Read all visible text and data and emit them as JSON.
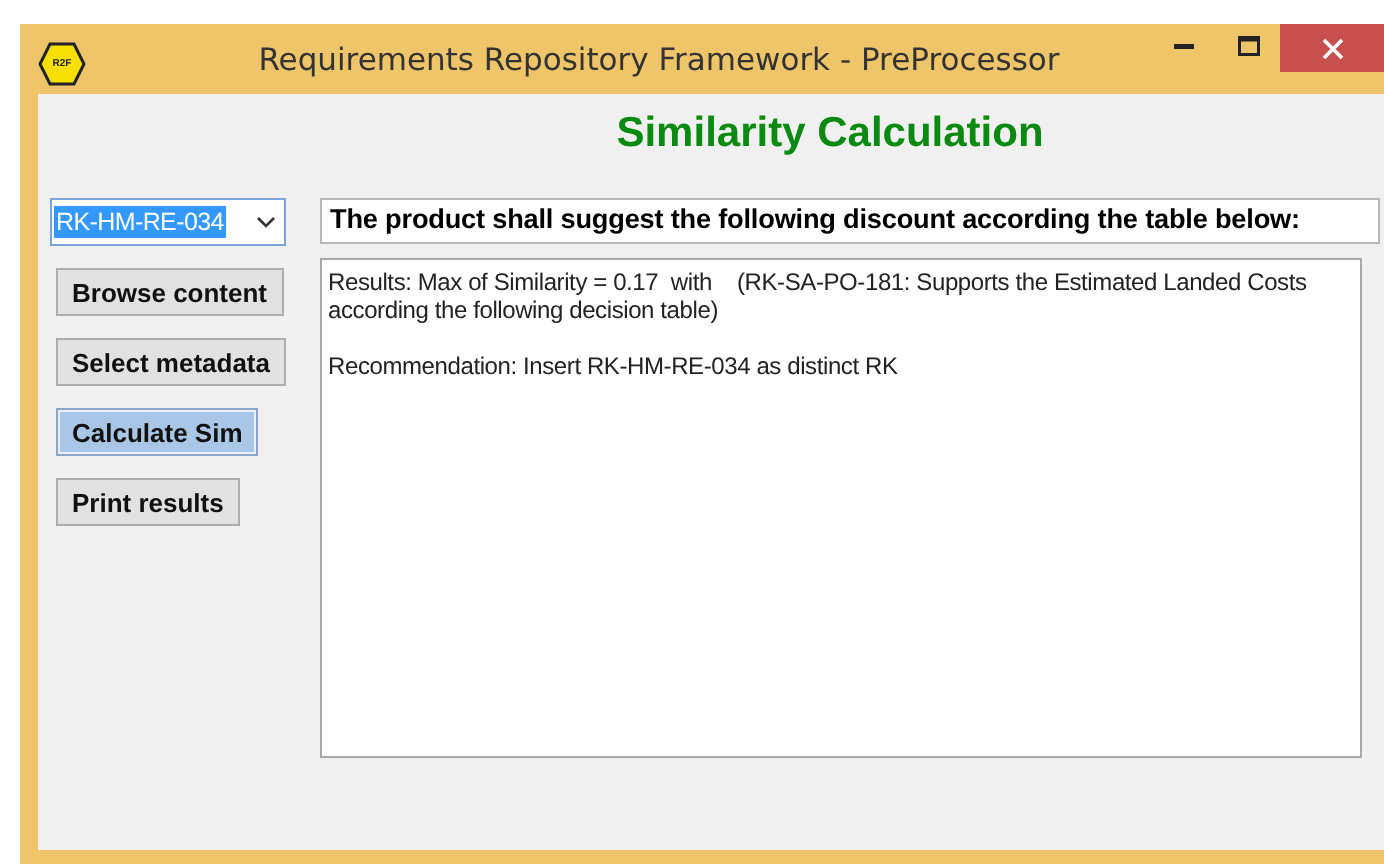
{
  "window": {
    "title": "Requirements Repository Framework - PreProcessor",
    "logo": "R2F"
  },
  "heading": "Similarity Calculation",
  "requirement_select": {
    "value": "RK-HM-RE-034",
    "highlighted": true
  },
  "requirement_text": "The product shall suggest the following discount according the table below:",
  "buttons": [
    {
      "label": "Browse content",
      "selected": false
    },
    {
      "label": "Select metadata",
      "selected": false
    },
    {
      "label": "Calculate Sim",
      "selected": true
    },
    {
      "label": "Print results",
      "selected": false
    }
  ],
  "results": [
    "Results: Max of Similarity = 0.17  with    (RK-SA-PO-181: Supports the Estimated Landed Costs according the following decision table)",
    "Recommendation: Insert RK-HM-RE-034 as distinct RK"
  ]
}
